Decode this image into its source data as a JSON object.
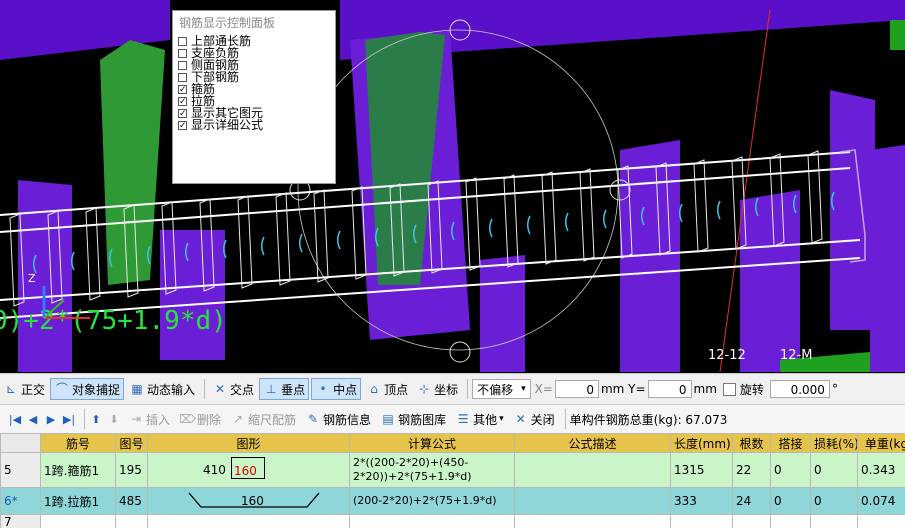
{
  "panel": {
    "title": "钢筋显示控制面板",
    "items": [
      {
        "label": "上部通长筋",
        "checked": false
      },
      {
        "label": "支座负筋",
        "checked": false
      },
      {
        "label": "侧面钢筋",
        "checked": false
      },
      {
        "label": "下部钢筋",
        "checked": false
      },
      {
        "label": "箍筋",
        "checked": true
      },
      {
        "label": "拉筋",
        "checked": true
      },
      {
        "label": "显示其它图元",
        "checked": true
      },
      {
        "label": "显示详细公式",
        "checked": true
      }
    ]
  },
  "viewport": {
    "formula_overlay": "0)+2*(75+1.9*d)",
    "axis_z": "Z",
    "cut_label_1": "12-12",
    "cut_label_2": "12-M"
  },
  "snapbar": {
    "ortho": "正交",
    "object_snap": "对象捕捉",
    "dynamic_input": "动态输入",
    "intersection": "交点",
    "perpendicular": "垂点",
    "midpoint": "中点",
    "vertex": "顶点",
    "coordinate": "坐标",
    "offset_mode": "不偏移",
    "x_label": "X=",
    "x_value": "0",
    "y_label": "mm Y=",
    "y_value": "0",
    "y_unit": "mm",
    "rotate_label": "旋转",
    "rotate_value": "0.000",
    "deg": "°"
  },
  "toolbar": {
    "insert": "插入",
    "delete": "删除",
    "scale_rebar": "缩尺配筋",
    "rebar_info": "钢筋信息",
    "rebar_library": "钢筋图库",
    "other": "其他",
    "close": "关闭",
    "total_weight": "单构件钢筋总重(kg): 67.073"
  },
  "grid": {
    "headers": [
      "筋号",
      "图号",
      "图形",
      "计算公式",
      "公式描述",
      "长度(mm)",
      "根数",
      "搭接",
      "损耗(%)",
      "单重(kg"
    ],
    "rows": [
      {
        "row_no": "5",
        "name": "1跨.箍筋1",
        "figure_no": "195",
        "shape_a": "410",
        "shape_b": "160",
        "formula": "2*((200-2*20)+(450-2*20))+2*(75+1.9*d)",
        "description": "",
        "length": "1315",
        "count": "22",
        "lap": "0",
        "loss": "0",
        "unit_weight": "0.343"
      },
      {
        "row_no": "6*",
        "name": "1跨.拉筋1",
        "figure_no": "485",
        "shape_a": "160",
        "formula": "(200-2*20)+2*(75+1.9*d)",
        "description": "",
        "length": "333",
        "count": "24",
        "lap": "0",
        "loss": "0",
        "unit_weight": "0.074"
      }
    ],
    "empty_row_no": "7"
  },
  "colors": {
    "viewport_bg": "#000000",
    "beam_purple": "#6a1fd6",
    "column_green": "#2f9a35",
    "rebar_white": "#ffffff",
    "tie_cyan": "#39c6ea",
    "formula_green": "#29e33a",
    "header_gold": "#e6c34a",
    "row_green": "#c9f5c9",
    "row_teal": "#8fd6d8"
  }
}
